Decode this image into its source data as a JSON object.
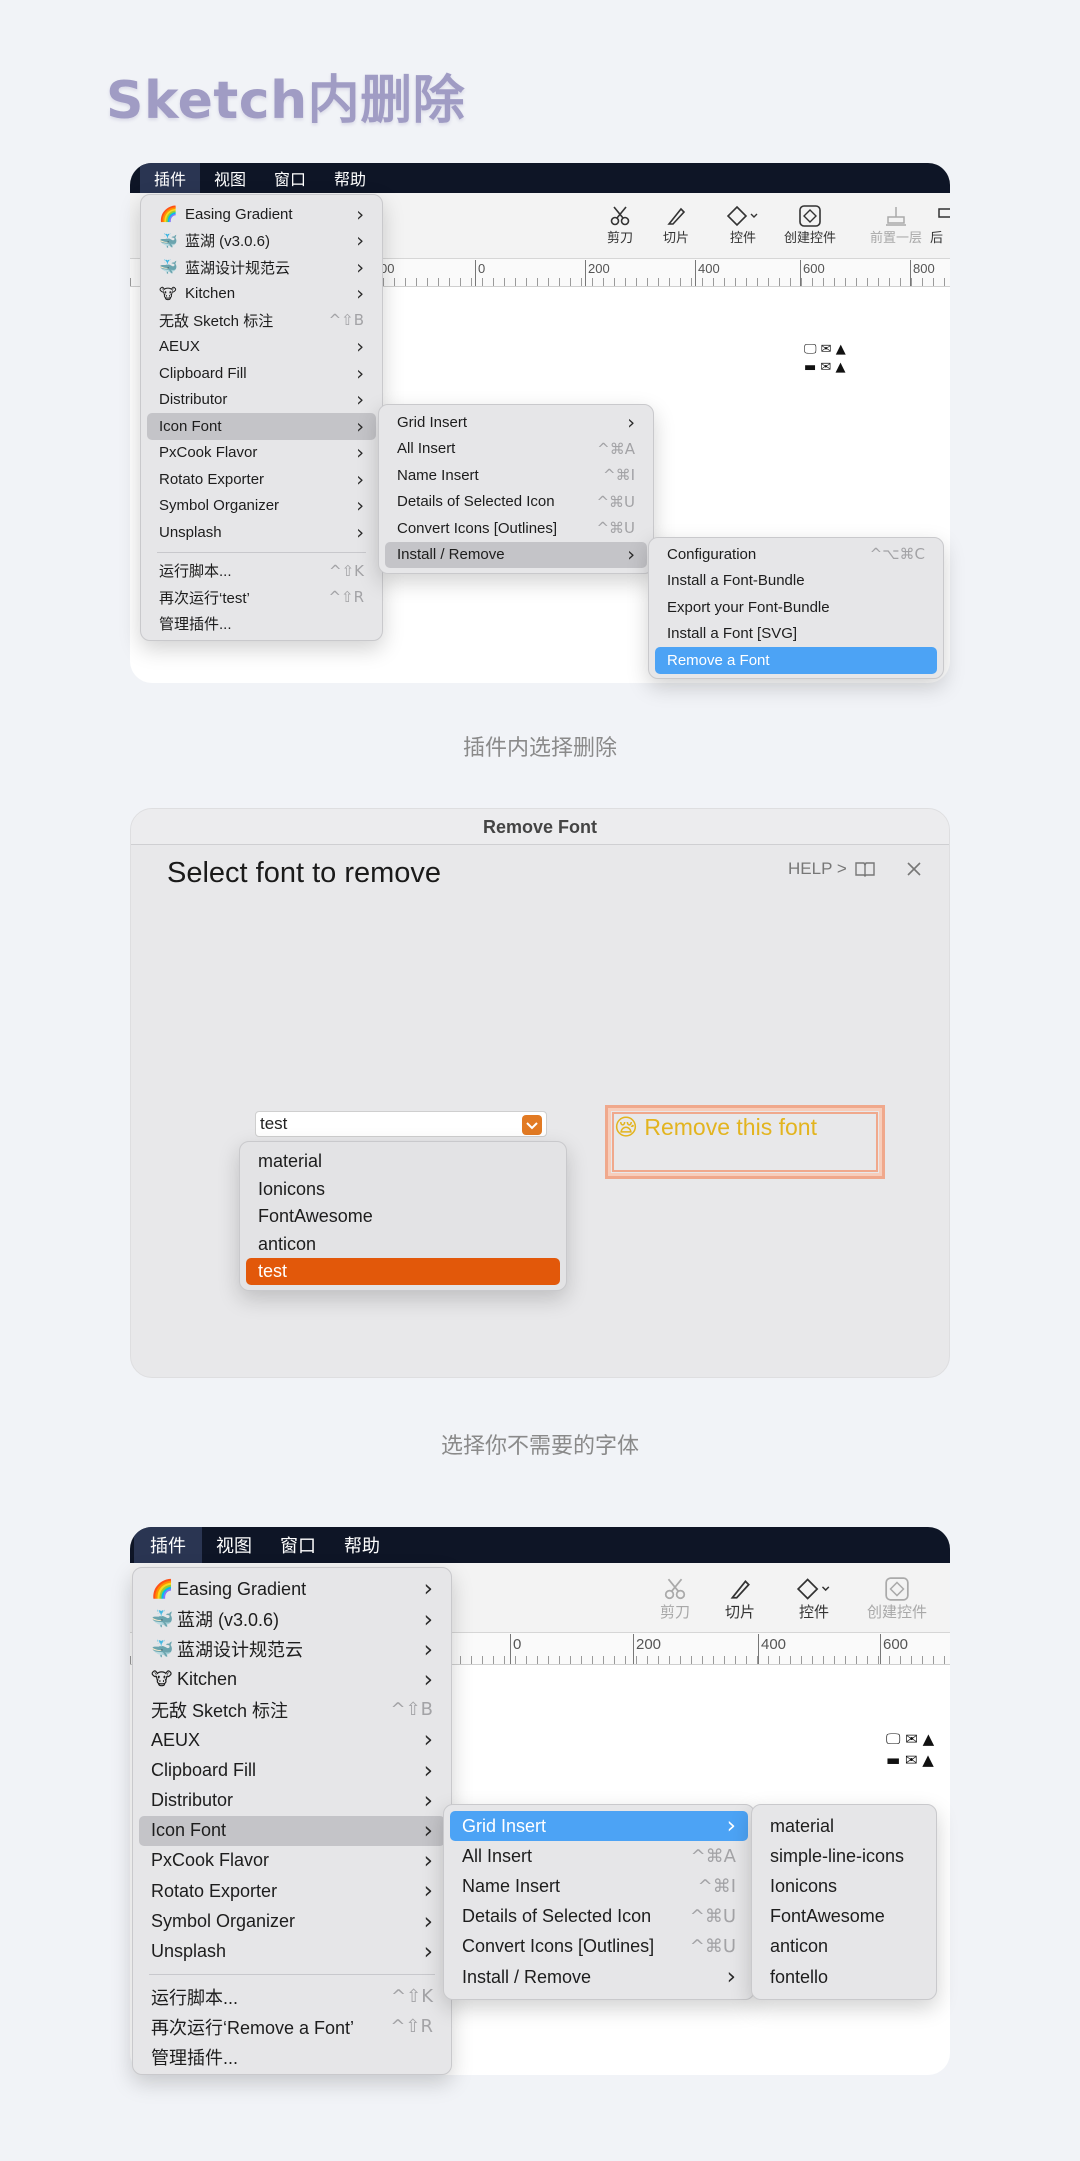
{
  "page_title": "Sketch内删除",
  "captions": {
    "first": "插件内选择删除",
    "second": "选择你不需要的字体"
  },
  "menubar": [
    "插件",
    "视图",
    "窗口",
    "帮助"
  ],
  "toolbar_top": [
    "剪刀",
    "切片",
    "控件",
    "创建控件",
    "前置一层",
    "后"
  ],
  "toolbar_bottom": [
    "剪刀",
    "切片",
    "控件",
    "创建控件"
  ],
  "ruler_top": [
    "00",
    "0",
    "200",
    "400",
    "600",
    "800"
  ],
  "ruler_bottom": [
    "0",
    "200",
    "400",
    "600"
  ],
  "plugins_menu_top": {
    "items": [
      {
        "icon": "🌈",
        "label": "Easing Gradient",
        "shortcut": "",
        "submenu": true
      },
      {
        "icon": "🐳",
        "label": "蓝湖 (v3.0.6)",
        "shortcut": "",
        "submenu": true
      },
      {
        "icon": "🐳",
        "label": "蓝湖设计规范云",
        "shortcut": "",
        "submenu": true
      },
      {
        "icon": "🐮",
        "label": "Kitchen",
        "shortcut": "",
        "submenu": true
      },
      {
        "icon": "",
        "label": "无敌 Sketch 标注",
        "shortcut": "^⇧B",
        "submenu": false
      },
      {
        "icon": "",
        "label": "AEUX",
        "shortcut": "",
        "submenu": true
      },
      {
        "icon": "",
        "label": "Clipboard Fill",
        "shortcut": "",
        "submenu": true
      },
      {
        "icon": "",
        "label": "Distributor",
        "shortcut": "",
        "submenu": true
      },
      {
        "icon": "",
        "label": "Icon Font",
        "shortcut": "",
        "submenu": true
      },
      {
        "icon": "",
        "label": "PxCook Flavor",
        "shortcut": "",
        "submenu": true
      },
      {
        "icon": "",
        "label": "Rotato Exporter",
        "shortcut": "",
        "submenu": true
      },
      {
        "icon": "",
        "label": "Symbol Organizer",
        "shortcut": "",
        "submenu": true
      },
      {
        "icon": "",
        "label": "Unsplash",
        "shortcut": "",
        "submenu": true
      },
      {
        "icon": "",
        "label": "运行脚本...",
        "shortcut": "^⇧K",
        "submenu": false
      },
      {
        "icon": "",
        "label": "再次运行‘test’",
        "shortcut": "^⇧R",
        "submenu": false
      },
      {
        "icon": "",
        "label": "管理插件...",
        "shortcut": "",
        "submenu": false
      }
    ]
  },
  "iconfont_menu_top": {
    "items": [
      {
        "label": "Grid Insert",
        "shortcut": "",
        "submenu": true
      },
      {
        "label": "All Insert",
        "shortcut": "^⌘A",
        "submenu": false
      },
      {
        "label": "Name Insert",
        "shortcut": "^⌘I",
        "submenu": false
      },
      {
        "label": "Details of Selected Icon",
        "shortcut": "^⌘U",
        "submenu": false
      },
      {
        "label": "Convert Icons [Outlines]",
        "shortcut": "^⌘U",
        "submenu": false
      },
      {
        "label": "Install / Remove",
        "shortcut": "",
        "submenu": true
      }
    ]
  },
  "install_remove_menu": {
    "items": [
      {
        "label": "Configuration",
        "shortcut": "^⌥⌘C"
      },
      {
        "label": "Install a Font-Bundle",
        "shortcut": ""
      },
      {
        "label": "Export your Font-Bundle",
        "shortcut": ""
      },
      {
        "label": "Install a Font [SVG]",
        "shortcut": ""
      },
      {
        "label": "Remove a Font",
        "shortcut": ""
      }
    ]
  },
  "dialog": {
    "title": "Remove Font",
    "heading": "Select font to remove",
    "help": "HELP >",
    "select_value": "test",
    "options": [
      "material",
      "Ionicons",
      "FontAwesome",
      "anticon",
      "test"
    ],
    "remove_button": "Remove this font",
    "remove_emoji": "😪"
  },
  "plugins_menu_bottom": {
    "items": [
      {
        "icon": "🌈",
        "label": "Easing Gradient",
        "shortcut": "",
        "submenu": true
      },
      {
        "icon": "🐳",
        "label": "蓝湖 (v3.0.6)",
        "shortcut": "",
        "submenu": true
      },
      {
        "icon": "🐳",
        "label": "蓝湖设计规范云",
        "shortcut": "",
        "submenu": true
      },
      {
        "icon": "🐮",
        "label": "Kitchen",
        "shortcut": "",
        "submenu": true
      },
      {
        "icon": "",
        "label": "无敌 Sketch 标注",
        "shortcut": "^⇧B",
        "submenu": false
      },
      {
        "icon": "",
        "label": "AEUX",
        "shortcut": "",
        "submenu": true
      },
      {
        "icon": "",
        "label": "Clipboard Fill",
        "shortcut": "",
        "submenu": true
      },
      {
        "icon": "",
        "label": "Distributor",
        "shortcut": "",
        "submenu": true
      },
      {
        "icon": "",
        "label": "Icon Font",
        "shortcut": "",
        "submenu": true
      },
      {
        "icon": "",
        "label": "PxCook Flavor",
        "shortcut": "",
        "submenu": true
      },
      {
        "icon": "",
        "label": "Rotato Exporter",
        "shortcut": "",
        "submenu": true
      },
      {
        "icon": "",
        "label": "Symbol Organizer",
        "shortcut": "",
        "submenu": true
      },
      {
        "icon": "",
        "label": "Unsplash",
        "shortcut": "",
        "submenu": true
      },
      {
        "icon": "",
        "label": "运行脚本...",
        "shortcut": "^⇧K",
        "submenu": false
      },
      {
        "icon": "",
        "label": "再次运行‘Remove a Font’",
        "shortcut": "^⇧R",
        "submenu": false
      },
      {
        "icon": "",
        "label": "管理插件...",
        "shortcut": "",
        "submenu": false
      }
    ]
  },
  "iconfont_menu_bottom": {
    "items": [
      {
        "label": "Grid Insert",
        "shortcut": "",
        "submenu": true
      },
      {
        "label": "All Insert",
        "shortcut": "^⌘A",
        "submenu": false
      },
      {
        "label": "Name Insert",
        "shortcut": "^⌘I",
        "submenu": false
      },
      {
        "label": "Details of Selected Icon",
        "shortcut": "^⌘U",
        "submenu": false
      },
      {
        "label": "Convert Icons [Outlines]",
        "shortcut": "^⌘U",
        "submenu": false
      },
      {
        "label": "Install / Remove",
        "shortcut": "",
        "submenu": true
      }
    ]
  },
  "grid_insert_menu": {
    "items": [
      "material",
      "simple-line-icons",
      "Ionicons",
      "FontAwesome",
      "anticon",
      "fontello"
    ]
  },
  "colors": {
    "menubar": "#0e1526",
    "highlight_blue": "#4ca3f5",
    "highlight_gray": "#c4c4c8",
    "select_orange": "#e2580a",
    "remove_text": "#e3b41f"
  }
}
